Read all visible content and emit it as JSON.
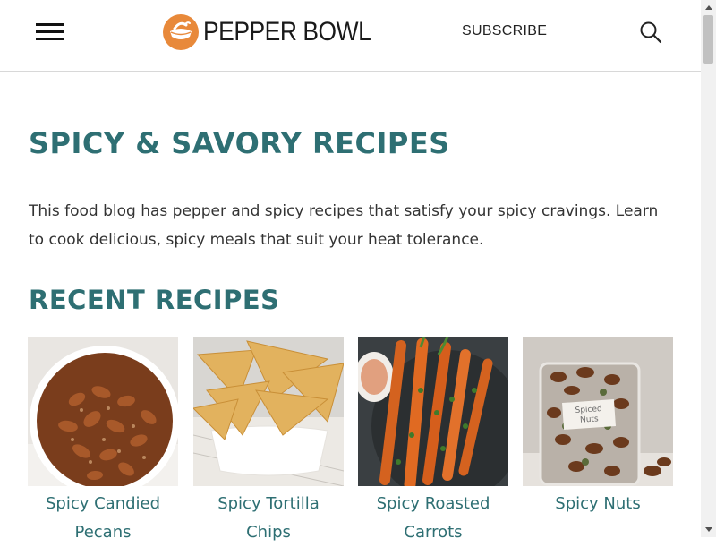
{
  "header": {
    "brand": "PEPPER BOWL",
    "subscribe_label": "SUBSCRIBE",
    "icons": {
      "menu": "hamburger-menu-icon",
      "search": "search-icon",
      "logo": "pepper-bowl-logo"
    }
  },
  "main": {
    "title": "SPICY & SAVORY RECIPES",
    "intro": "This food blog has pepper and spicy recipes that satisfy your spicy cravings. Learn to cook delicious, spicy meals that suit your heat tolerance.",
    "recent_heading": "RECENT RECIPES",
    "recipes": [
      {
        "title": "Spicy Candied Pecans"
      },
      {
        "title": "Spicy Tortilla Chips"
      },
      {
        "title": "Spicy Roasted Carrots"
      },
      {
        "title": "Spicy Nuts",
        "jar_label": "Spiced Nuts"
      }
    ]
  },
  "colors": {
    "accent": "#2e6f73",
    "logo_orange": "#e8893a",
    "text": "#333333"
  }
}
